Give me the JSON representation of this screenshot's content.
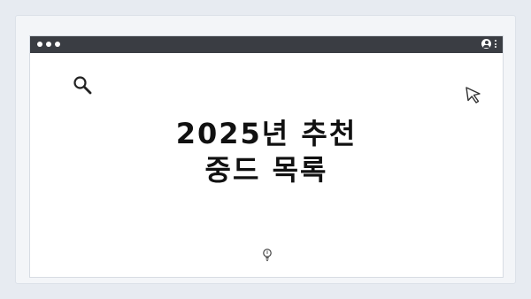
{
  "icons": {
    "search": "search-icon",
    "cursor": "cursor-icon",
    "bulb": "lightbulb-icon",
    "user": "user-icon",
    "menu": "kebab-menu-icon"
  },
  "colors": {
    "page_background": "#e7ebf1",
    "titlebar": "#3a3d43",
    "window": "#ffffff",
    "headline_text": "#111111"
  },
  "content": {
    "headline_line1": "2025년 추천",
    "headline_line2": "중드 목록"
  }
}
